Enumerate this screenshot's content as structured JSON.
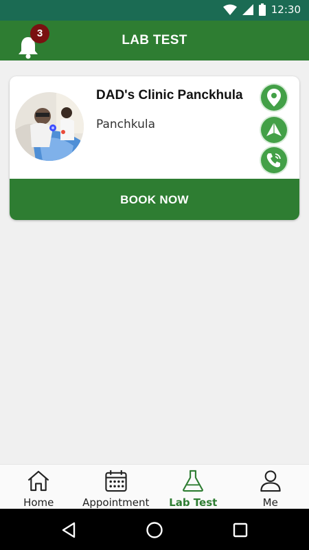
{
  "status_bar": {
    "time": "12:30",
    "icons": [
      "wifi-icon",
      "signal-icon",
      "battery-icon"
    ]
  },
  "app_bar": {
    "title": "LAB TEST",
    "notification_count": "3"
  },
  "clinic": {
    "name": "DAD's Clinic Panckhula",
    "location": "Panchkula",
    "book_label": "BOOK NOW",
    "actions": [
      "location-pin-icon",
      "directions-icon",
      "phone-icon"
    ]
  },
  "bottom_nav": {
    "items": [
      {
        "label": "Home",
        "icon": "home-icon"
      },
      {
        "label": "Appointment",
        "icon": "calendar-icon"
      },
      {
        "label": "Lab Test",
        "icon": "flask-icon",
        "active": true
      },
      {
        "label": "Me",
        "icon": "user-icon"
      }
    ]
  },
  "colors": {
    "primary": "#2e7d32",
    "status_bar": "#1b6b53",
    "badge": "#7a1111",
    "action": "#43a047"
  }
}
